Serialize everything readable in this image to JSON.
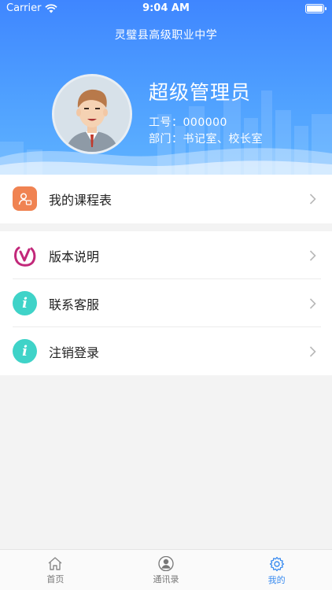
{
  "status_bar": {
    "carrier": "Carrier",
    "time": "9:04 AM"
  },
  "header": {
    "school_name": "灵璧县高级职业中学",
    "user_name": "超级管理员",
    "employee_id": "工号：000000",
    "department": "部门：书记室、校长室"
  },
  "menu": {
    "group1": [
      {
        "label": "我的课程表",
        "icon": "schedule-icon"
      }
    ],
    "group2": [
      {
        "label": "版本说明",
        "icon": "version-icon"
      },
      {
        "label": "联系客服",
        "icon": "info-icon"
      },
      {
        "label": "注销登录",
        "icon": "info-icon"
      }
    ]
  },
  "tabbar": {
    "tabs": [
      {
        "label": "首页",
        "icon": "home-icon",
        "active": false
      },
      {
        "label": "通讯录",
        "icon": "contacts-icon",
        "active": false
      },
      {
        "label": "我的",
        "icon": "gear-icon",
        "active": true
      }
    ]
  },
  "colors": {
    "header_blue": "#3f86ff",
    "accent": "#3b8cf0",
    "schedule_icon": "#f08352",
    "info_icon": "#3fd3c8",
    "version_icon": "#c2287a"
  }
}
